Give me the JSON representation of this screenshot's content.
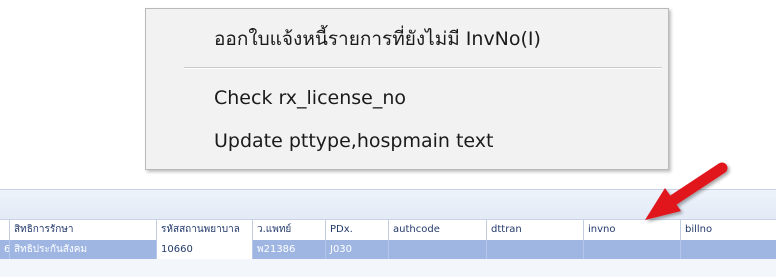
{
  "context_menu": {
    "items": [
      {
        "label": "ออกใบแจ้งหนี้รายการที่ยังไม่มี InvNo(I)"
      },
      {
        "label": "Check rx_license_no"
      },
      {
        "label": "Update pttype,hospmain text"
      }
    ]
  },
  "grid": {
    "columns": [
      {
        "label": ""
      },
      {
        "label": "สิทธิการรักษา"
      },
      {
        "label": "รหัสสถานพยาบาล"
      },
      {
        "label": "ว.แพทย์"
      },
      {
        "label": "PDx."
      },
      {
        "label": "authcode"
      },
      {
        "label": "dttran"
      },
      {
        "label": "invno"
      },
      {
        "label": "billno"
      }
    ],
    "rows": [
      {
        "cells": [
          "62",
          "สิทธิประกันสังคม",
          "10660",
          "พ21386",
          "J030",
          "",
          "",
          "",
          ""
        ]
      }
    ]
  },
  "colors": {
    "selection": "#9fb6e3",
    "arrow": "#e0141e",
    "menu_bg": "#f2f2f2"
  }
}
